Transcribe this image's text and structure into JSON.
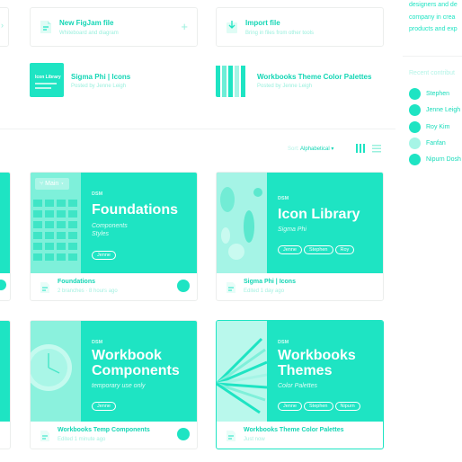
{
  "actions": [
    {
      "title": "New FigJam file",
      "subtitle": "Whiteboard and diagram",
      "icon": "figjam-file-icon",
      "extra": "+"
    },
    {
      "title": "Import file",
      "subtitle": "Bring in files from other tools",
      "icon": "import-icon"
    }
  ],
  "recent": [
    {
      "name": "Sigma Phi | Icons",
      "sub": "Posted by Jenne Leigh",
      "thumb_label": "Icon Library"
    },
    {
      "name": "Workbooks Theme Color Palettes",
      "sub": "Posted by Jenne Leigh"
    }
  ],
  "sort": {
    "label": "Sort:",
    "value": "Alphabetical"
  },
  "cards": [
    {
      "dsm": "DSM",
      "title": "Foundations",
      "sub1": "Components",
      "sub2": "Styles",
      "pills": [
        "Jenne"
      ],
      "branch": "Main",
      "file_name": "Foundations",
      "file_sub": "2 branches · 8 hours ago"
    },
    {
      "dsm": "DSM",
      "title": "Icon Library",
      "sub1": "Sigma Phi",
      "pills": [
        "Jenne",
        "Stephen",
        "Roy"
      ],
      "file_name": "Sigma Phi | Icons",
      "file_sub": "Edited 1 day ago"
    },
    {
      "dsm": "DSM",
      "title_l1": "Workbook",
      "title_l2": "Components",
      "sub1": "temporary use only",
      "pills": [
        "Jenne"
      ],
      "file_name": "Workbooks Temp Components",
      "file_sub": "Edited 1 minute ago"
    },
    {
      "dsm": "DSM",
      "title_l1": "Workbooks",
      "title_l2": "Themes",
      "sub1": "Color Palettes",
      "pills": [
        "Jenne",
        "Stephen",
        "Nipurn"
      ],
      "file_name": "Workbooks Theme Color Palettes",
      "file_sub": "Just now"
    }
  ],
  "sidebar": {
    "desc_lines": [
      "designers and de",
      "company in crea",
      "products and exp"
    ],
    "heading": "Recent contribut",
    "contributors": [
      "Stephen",
      "Jenne Leigh",
      "Roy Kim",
      "Fanfan",
      "Nipurn Dosh"
    ]
  },
  "colors": {
    "accent": "#1ee4c3"
  }
}
